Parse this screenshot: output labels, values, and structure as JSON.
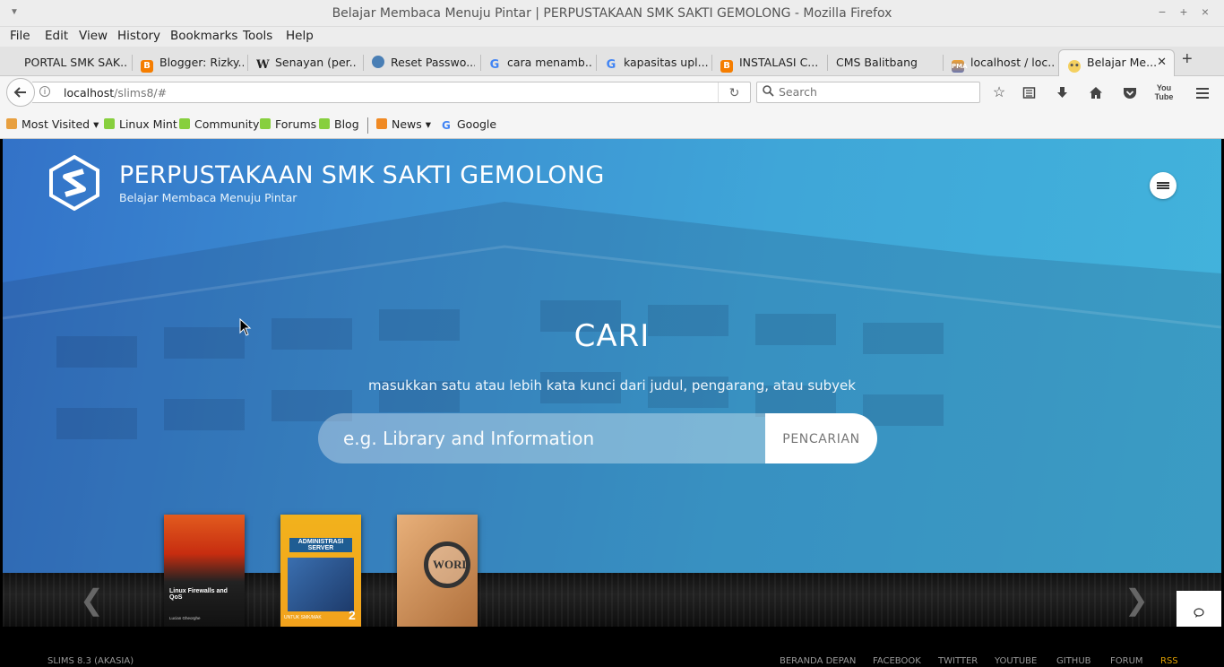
{
  "window": {
    "title": "Belajar Membaca Menuju Pintar | PERPUSTAKAAN SMK SAKTI GEMOLONG - Mozilla Firefox",
    "minimize": "−",
    "maximize": "+",
    "close": "×"
  },
  "menu": [
    "File",
    "Edit",
    "View",
    "History",
    "Bookmarks",
    "Tools",
    "Help"
  ],
  "tabs": [
    {
      "label": "PORTAL SMK SAK...",
      "icon": "none",
      "color": ""
    },
    {
      "label": "Blogger: Rizky...",
      "icon": "blogger-icon",
      "color": "#f57d00"
    },
    {
      "label": "Senayan (per...",
      "icon": "wikipedia-icon",
      "color": ""
    },
    {
      "label": "Reset Passwo...",
      "icon": "globe-icon",
      "color": "#4a7fb5"
    },
    {
      "label": "cara menamb...",
      "icon": "google-icon",
      "color": ""
    },
    {
      "label": "kapasitas upl...",
      "icon": "google-icon",
      "color": ""
    },
    {
      "label": "INSTALASI C...",
      "icon": "blogger-icon",
      "color": "#f57d00"
    },
    {
      "label": "CMS Balitbang",
      "icon": "none",
      "color": ""
    },
    {
      "label": "localhost / loc...",
      "icon": "phpmyadmin-icon",
      "color": "#f0a030"
    },
    {
      "label": "Belajar Me...",
      "icon": "smiley-icon",
      "color": "#f4d060"
    }
  ],
  "nav": {
    "url_host": "localhost",
    "url_path": "/slims8/#",
    "search_placeholder": "Search"
  },
  "bookmarks": [
    {
      "label": "Most Visited",
      "dropdown": true
    },
    {
      "label": "Linux Mint",
      "dropdown": false
    },
    {
      "label": "Community",
      "dropdown": false
    },
    {
      "label": "Forums",
      "dropdown": false
    },
    {
      "label": "Blog",
      "dropdown": false
    },
    {
      "label": "News",
      "dropdown": true
    },
    {
      "label": "Google",
      "dropdown": false
    }
  ],
  "site": {
    "title": "PERPUSTAKAAN SMK SAKTI GEMOLONG",
    "subtitle": "Belajar Membaca Menuju Pintar",
    "search_heading": "CARI",
    "search_hint": "masukkan satu atau lebih kata kunci dari judul, pengarang, atau subyek",
    "search_placeholder": "e.g. Library and Information",
    "search_button": "PENCARIAN"
  },
  "books": [
    {
      "title": "Linux Firewalls and QoS",
      "author": "Lucian Gheorghe",
      "color": "#d9441a"
    },
    {
      "title": "ADMINISTRASI SERVER",
      "subtitle": "UNTUK SMK/MAK",
      "number": "2",
      "color": "#f2a91c"
    },
    {
      "title": "WORD",
      "color": "#c98a50"
    }
  ],
  "footer": {
    "version": "SLIMS 8.3 (AKASIA)",
    "links": [
      "BERANDA DEPAN",
      "FACEBOOK",
      "TWITTER",
      "YOUTUBE",
      "GITHUB",
      "FORUM",
      "RSS"
    ]
  }
}
